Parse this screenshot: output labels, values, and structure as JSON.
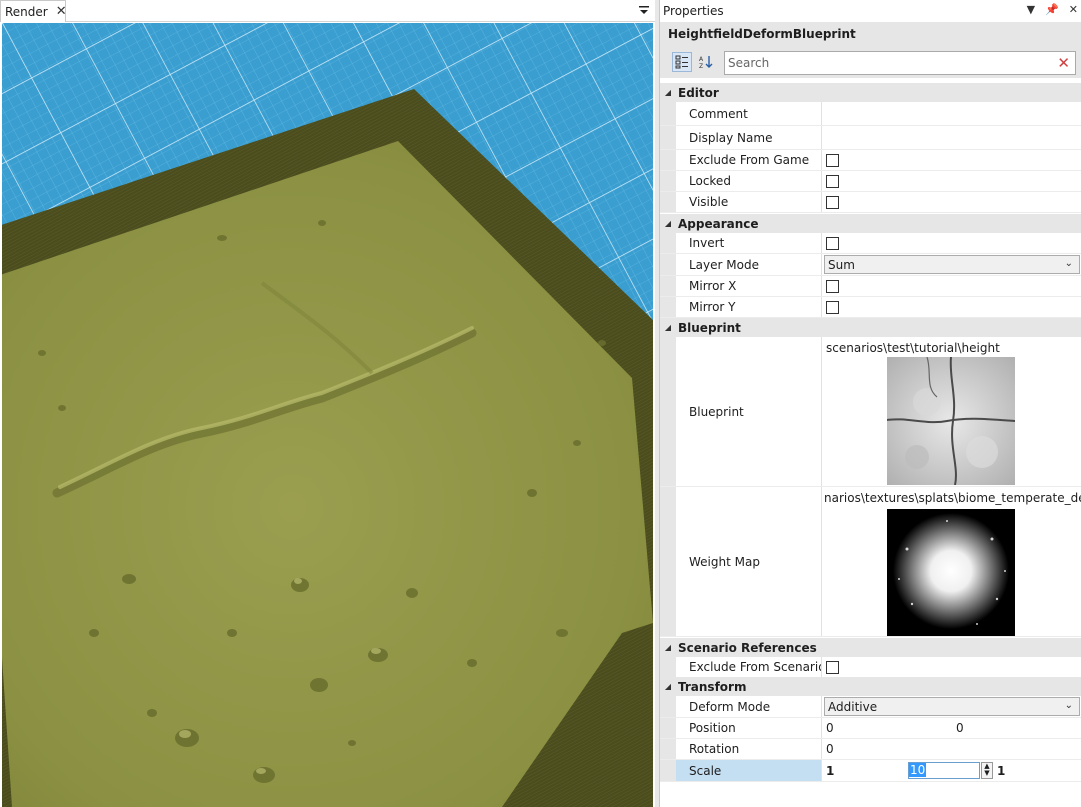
{
  "render_tab": {
    "label": "Render"
  },
  "properties": {
    "title": "Properties",
    "object_name": "HeightfieldDeformBlueprint",
    "search": {
      "placeholder": "Search",
      "value": ""
    }
  },
  "categories": {
    "editor": "Editor",
    "appearance": "Appearance",
    "blueprint": "Blueprint",
    "scenario_refs": "Scenario References",
    "transform": "Transform"
  },
  "props": {
    "comment": {
      "name": "Comment",
      "value": ""
    },
    "display_name": {
      "name": "Display Name",
      "value": ""
    },
    "exclude_from_game": {
      "name": "Exclude From Game",
      "checked": false
    },
    "locked": {
      "name": "Locked",
      "checked": false
    },
    "visible": {
      "name": "Visible",
      "checked": false
    },
    "invert": {
      "name": "Invert",
      "checked": false
    },
    "layer_mode": {
      "name": "Layer Mode",
      "value": "Sum"
    },
    "mirror_x": {
      "name": "Mirror X",
      "checked": false
    },
    "mirror_y": {
      "name": "Mirror Y",
      "checked": false
    },
    "blueprint": {
      "name": "Blueprint",
      "path": "scenarios\\test\\tutorial\\height"
    },
    "weight_map": {
      "name": "Weight Map",
      "path": "narios\\textures\\splats\\biome_temperate_deciduo"
    },
    "exclude_from_scenario": {
      "name": "Exclude From Scenario...",
      "checked": false
    },
    "deform_mode": {
      "name": "Deform Mode",
      "value": "Additive"
    },
    "position": {
      "name": "Position",
      "x": "0",
      "y": "0"
    },
    "rotation": {
      "name": "Rotation",
      "value": "0"
    },
    "scale": {
      "name": "Scale",
      "x": "1",
      "y": "10",
      "z": "1"
    }
  },
  "colors": {
    "grid_blue": "#3a9ed0",
    "terrain": "#8f9447",
    "terrain_border": "#4f5020",
    "selection": "#c4def2"
  }
}
